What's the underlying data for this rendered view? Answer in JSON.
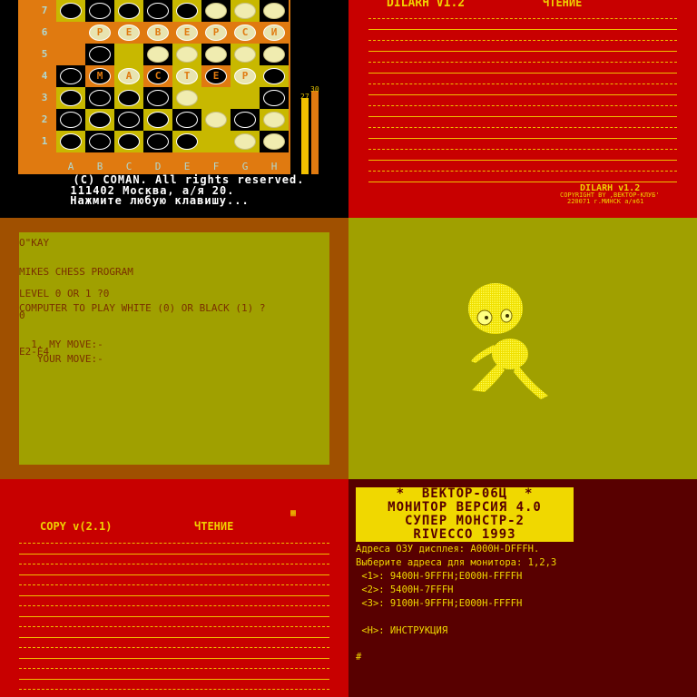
{
  "reversi": {
    "row_labels": [
      "7",
      "6",
      "5",
      "4",
      "3",
      "2",
      "1"
    ],
    "col_labels": [
      "A",
      "B",
      "C",
      "D",
      "E",
      "F",
      "G",
      "H"
    ],
    "title_word": [
      "Р",
      "Е",
      "В",
      "Е",
      "Р",
      "С",
      "И"
    ],
    "master_word": [
      "М",
      "А",
      "С",
      "Т",
      "Е",
      "Р"
    ],
    "score_left": "27",
    "score_right": "30",
    "copyright": "(C) COMAN. All rights reserved.",
    "address": "111402 Москва, а/я 20.",
    "prompt": "Нажмите любую клавишу...",
    "colors": {
      "orange": "#e07a10",
      "yellow": "#c8b800",
      "cyan_label": "#b0d8d0"
    }
  },
  "dilarh": {
    "title": "DILARH V1.2",
    "mode": "ЧТЕНИЕ",
    "brand": "DILARH v1.2",
    "copyright_line": "COPYRIGHT BY ,ВЕКТОР-КЛУБ'",
    "address_line": "220071 г.МИНСК а/я61"
  },
  "chess": {
    "lines": [
      "O\"KAY",
      "MIKES CHESS PROGRAM",
      "LEVEL 0 OR 1 ?0",
      "COMPUTER TO PLAY WHITE (0) OR BLACK (1) ?",
      "0",
      "  1. MY MOVE:-",
      "E2-E4",
      "   YOUR MOVE:-"
    ]
  },
  "copy": {
    "title": "COPY v(2.1)",
    "mode": "ЧТЕНИЕ"
  },
  "monitor": {
    "banner": [
      "*  ВЕКТОР-06Ц  *",
      "МОНИТОР ВЕРСИЯ 4.0",
      "СУПЕР МОНСТР-2",
      "RIVECCO 1993"
    ],
    "lines": [
      "Адреса ОЗУ дисплея: A000H-DFFFH.",
      "Выберите адреса для монитора: 1,2,3",
      " <1>: 9400H-9FFFH;E000H-FFFFH",
      " <2>: 5400H-7FFFH",
      " <3>: 9100H-9FFFH;E000H-FFFFH",
      "",
      " <H>: ИНСТРУКЦИЯ",
      "",
      "#"
    ]
  }
}
